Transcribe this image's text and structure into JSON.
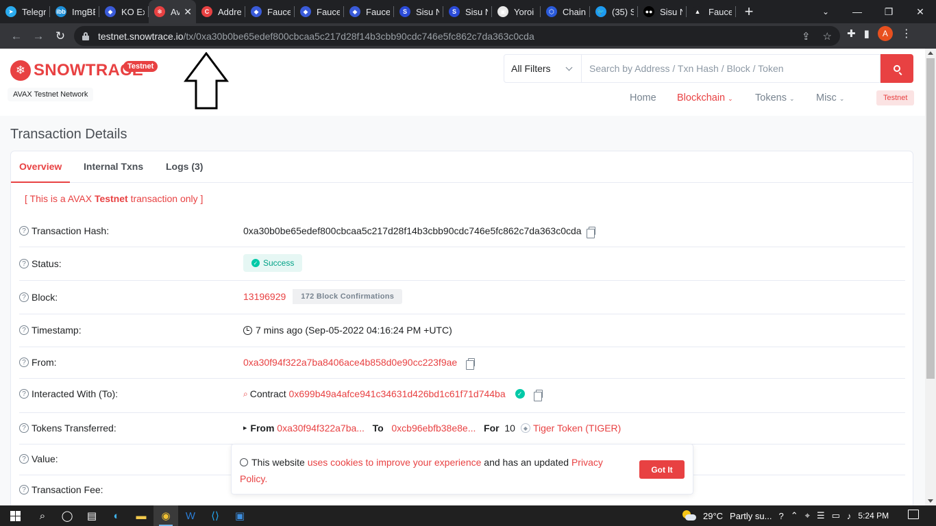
{
  "browser": {
    "tabs": [
      {
        "title": "Telegr",
        "color": "#2aabee",
        "glyph": "➤"
      },
      {
        "title": "ImgBB",
        "color": "#1d8fd8",
        "glyph": "ibb"
      },
      {
        "title": "KO Ex",
        "color": "#3a5bd9",
        "glyph": "◆"
      },
      {
        "title": "Av",
        "color": "#e84142",
        "glyph": "❄",
        "active": true
      },
      {
        "title": "Addre",
        "color": "#e84142",
        "glyph": "C"
      },
      {
        "title": "Fauce",
        "color": "#3a5bd9",
        "glyph": "◆"
      },
      {
        "title": "Fauce",
        "color": "#3a5bd9",
        "glyph": "◆"
      },
      {
        "title": "Fauce",
        "color": "#3a5bd9",
        "glyph": "◆"
      },
      {
        "title": "Sisu N",
        "color": "#2b4bd8",
        "glyph": "S"
      },
      {
        "title": "Sisu N",
        "color": "#2b4bd8",
        "glyph": "S"
      },
      {
        "title": "Yoroi",
        "color": "#e8e8e8",
        "glyph": "▣"
      },
      {
        "title": "Chain",
        "color": "#2a5ada",
        "glyph": "⬡"
      },
      {
        "title": "(35) S",
        "color": "#1d9bf0",
        "glyph": "🐦"
      },
      {
        "title": "Sisu N",
        "color": "#000000",
        "glyph": "●●"
      },
      {
        "title": "Fauce",
        "color": "#202124",
        "glyph": "▲"
      }
    ],
    "new_tab": "+",
    "url_host": "testnet.snowtrace.io",
    "url_path": "/tx/0xa30b0be65edef800cbcaa5c217d28f14b3cbb90cdc746e5fc862c7da363c0cda",
    "profile_initial": "A"
  },
  "site": {
    "logo_text": "SNOWTRACE",
    "logo_badge": "Testnet",
    "network": "AVAX Testnet Network",
    "filter_label": "All Filters",
    "search_placeholder": "Search by Address / Txn Hash / Block / Token",
    "nav": {
      "home": "Home",
      "blockchain": "Blockchain",
      "tokens": "Tokens",
      "misc": "Misc",
      "badge": "Testnet"
    }
  },
  "page": {
    "title": "Transaction Details",
    "tabs": [
      "Overview",
      "Internal Txns",
      "Logs (3)"
    ],
    "notice_prefix": "[ This is a AVAX ",
    "notice_bold": "Testnet",
    "notice_suffix": " transaction only ]",
    "labels": {
      "hash": "Transaction Hash:",
      "status": "Status:",
      "block": "Block:",
      "timestamp": "Timestamp:",
      "from": "From:",
      "to": "Interacted With (To):",
      "tokens": "Tokens Transferred:",
      "value": "Value:",
      "fee": "Transaction Fee:"
    },
    "tx_hash": "0xa30b0be65edef800cbcaa5c217d28f14b3cbb90cdc746e5fc862c7da363c0cda",
    "status": "Success",
    "block_number": "13196929",
    "confirmations": "172 Block Confirmations",
    "timestamp": "7 mins ago (Sep-05-2022 04:16:24 PM +UTC)",
    "from_address": "0xa30f94f322a7ba8406ace4b858d0e90cc223f9ae",
    "contract_label": "Contract",
    "contract_address": "0x699b49a4afce941c34631d426bd1c61f71d744ba",
    "transfer": {
      "from_label": "From",
      "from_short": "0xa30f94f322a7ba...",
      "to_label": "To",
      "to_short": "0xcb96ebfb38e8e...",
      "for_label": "For",
      "amount": "10",
      "token": "Tiger Token (TIGER)"
    }
  },
  "cookie": {
    "text1": "This website ",
    "link1": "uses cookies to improve your experience",
    "text2": " and has an updated ",
    "link2": "Privacy Policy",
    "text3": ".",
    "button": "Got It"
  },
  "taskbar": {
    "temperature": "29°C",
    "weather": "Partly su...",
    "time": "5:24 PM"
  },
  "colors": {
    "accent": "#e84142",
    "success": "#00c9a7"
  }
}
